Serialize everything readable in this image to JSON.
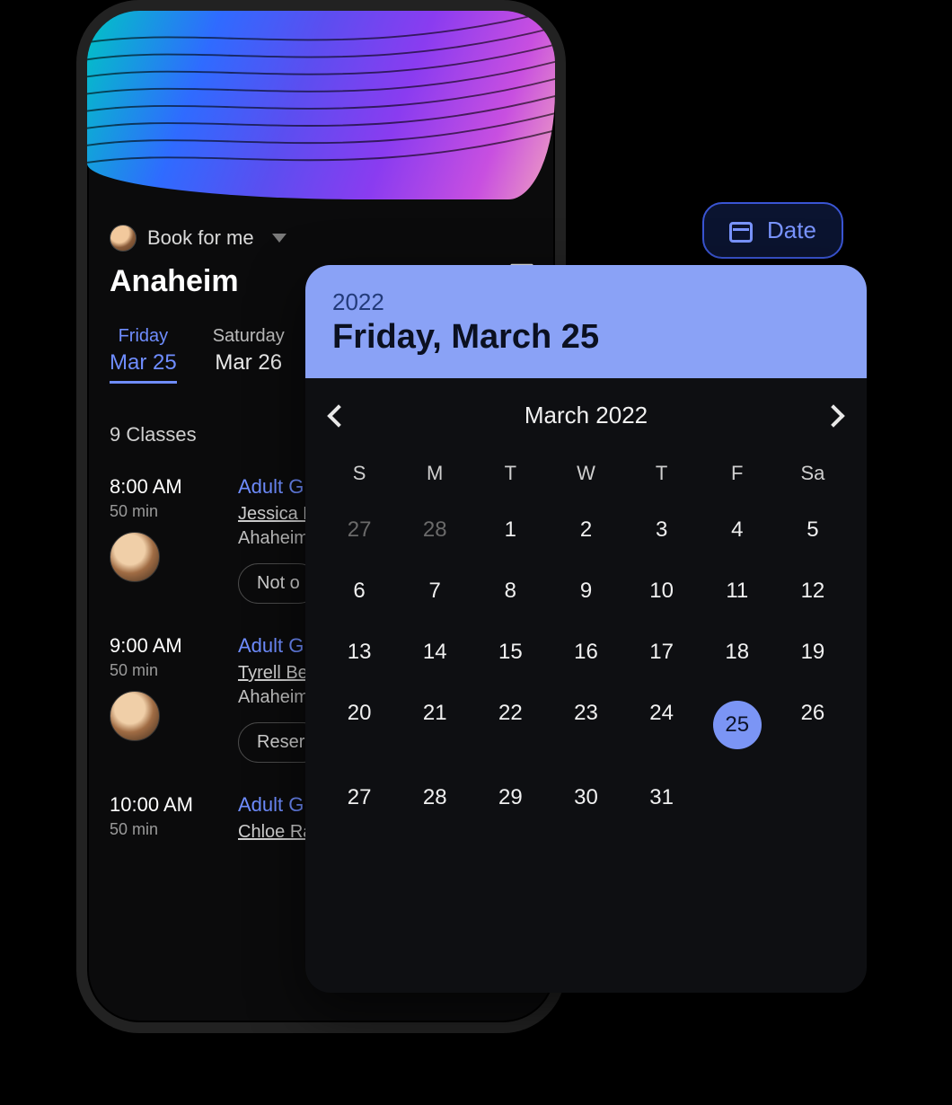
{
  "book_for": {
    "label": "Book for me"
  },
  "location": "Anaheim",
  "day_tabs": [
    {
      "dow": "Friday",
      "date": "Mar 25",
      "active": true
    },
    {
      "dow": "Saturday",
      "date": "Mar 26",
      "active": false
    }
  ],
  "class_count": "9 Classes",
  "classes": [
    {
      "time": "8:00 AM",
      "duration": "50 min",
      "title": "Adult G",
      "instructor": "Jessica F",
      "loc": "Ahaheim",
      "pill": "Not o"
    },
    {
      "time": "9:00 AM",
      "duration": "50 min",
      "title": "Adult G",
      "instructor": "Tyrell Be",
      "loc": "Ahaheim",
      "pill": "Reser"
    },
    {
      "time": "10:00 AM",
      "duration": "50 min",
      "title": "Adult G",
      "instructor": "Chloe Ra",
      "loc": "",
      "pill": ""
    }
  ],
  "date_chip": {
    "label": "Date"
  },
  "calendar": {
    "year": "2022",
    "full_date": "Friday, March 25",
    "month_label": "March 2022",
    "dow": [
      "S",
      "M",
      "T",
      "W",
      "T",
      "F",
      "Sa"
    ],
    "weeks": [
      [
        {
          "d": "27",
          "dim": true
        },
        {
          "d": "28",
          "dim": true
        },
        {
          "d": "1"
        },
        {
          "d": "2"
        },
        {
          "d": "3"
        },
        {
          "d": "4"
        },
        {
          "d": "5"
        }
      ],
      [
        {
          "d": "6"
        },
        {
          "d": "7"
        },
        {
          "d": "8"
        },
        {
          "d": "9"
        },
        {
          "d": "10"
        },
        {
          "d": "11"
        },
        {
          "d": "12"
        }
      ],
      [
        {
          "d": "13"
        },
        {
          "d": "14"
        },
        {
          "d": "15"
        },
        {
          "d": "16"
        },
        {
          "d": "17"
        },
        {
          "d": "18"
        },
        {
          "d": "19"
        }
      ],
      [
        {
          "d": "20"
        },
        {
          "d": "21"
        },
        {
          "d": "22"
        },
        {
          "d": "23"
        },
        {
          "d": "24"
        },
        {
          "d": "25",
          "sel": true
        },
        {
          "d": "26"
        }
      ],
      [
        {
          "d": "27"
        },
        {
          "d": "28"
        },
        {
          "d": "29"
        },
        {
          "d": "30"
        },
        {
          "d": "31"
        },
        {
          "d": ""
        },
        {
          "d": ""
        }
      ]
    ]
  }
}
